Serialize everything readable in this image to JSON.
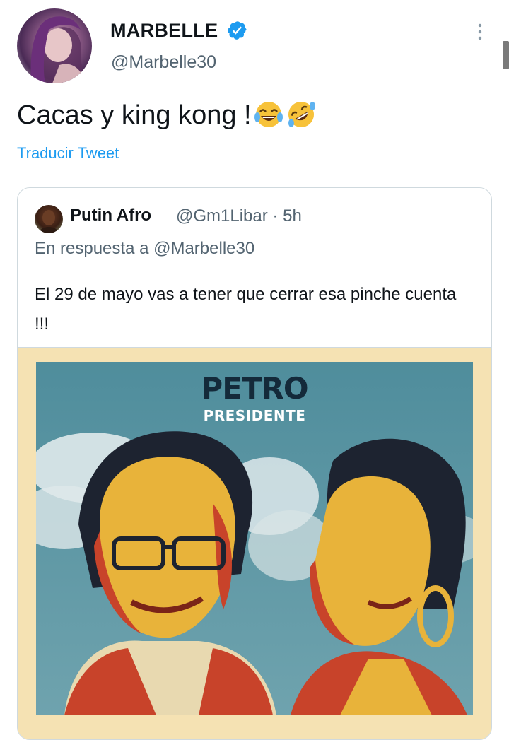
{
  "user": {
    "display_name": "MARBELLE",
    "handle": "@Marbelle30",
    "verified_icon": "verified-badge-icon",
    "menu_icon": "more-vertical-icon"
  },
  "tweet": {
    "text": "Cacas y king kong !",
    "emojis": [
      "face-with-tears-of-joy",
      "rolling-on-the-floor-laughing"
    ],
    "translate_label": "Traducir Tweet"
  },
  "quoted": {
    "name": "Putin Afro",
    "handle": "@Gm1Libar",
    "separator": "·",
    "time": "5h",
    "reply_to": "En respuesta a @Marbelle30",
    "text": "El 29 de mayo vas a tener que cerrar esa pinche cuenta !!!",
    "media": {
      "logo_text": "PETRO",
      "subtitle": "PRESIDENTE"
    }
  },
  "colors": {
    "link": "#1d9bf0",
    "secondary_text": "#536471",
    "verified": "#1d9bf0"
  }
}
